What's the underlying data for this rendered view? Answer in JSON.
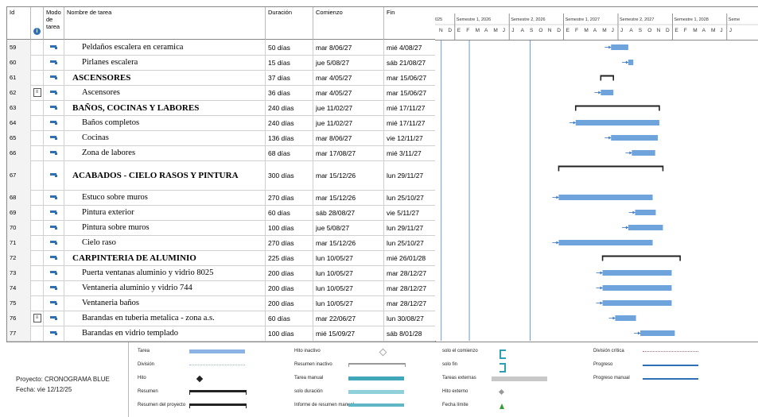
{
  "grid": {
    "headers": {
      "id": "Id",
      "mode": "Modo de tarea",
      "name": "Nombre de tarea",
      "duration": "Duración",
      "start": "Comienzo",
      "end": "Fin"
    },
    "rows": [
      {
        "id": "59",
        "info": "",
        "name": "Peldaños escalera en ceramica",
        "duration": "50 días",
        "start": "mar 8/06/27",
        "end": "mié 4/08/27",
        "summary": false,
        "indent": 2
      },
      {
        "id": "60",
        "info": "",
        "name": "Pirlanes escalera",
        "duration": "15 días",
        "start": "jue 5/08/27",
        "end": "sáb 21/08/27",
        "summary": false,
        "indent": 2
      },
      {
        "id": "61",
        "info": "",
        "name": "ASCENSORES",
        "duration": "37 días",
        "start": "mar 4/05/27",
        "end": "mar 15/06/27",
        "summary": true,
        "indent": 1
      },
      {
        "id": "62",
        "info": "note",
        "name": "Ascensores",
        "duration": "36 días",
        "start": "mar 4/05/27",
        "end": "mar 15/06/27",
        "summary": false,
        "indent": 2
      },
      {
        "id": "63",
        "info": "",
        "name": "BAÑOS, COCINAS Y LABORES",
        "duration": "240 días",
        "start": "jue 11/02/27",
        "end": "mié 17/11/27",
        "summary": true,
        "indent": 1
      },
      {
        "id": "64",
        "info": "",
        "name": "Baños completos",
        "duration": "240 días",
        "start": "jue 11/02/27",
        "end": "mié 17/11/27",
        "summary": false,
        "indent": 2
      },
      {
        "id": "65",
        "info": "",
        "name": "Cocinas",
        "duration": "136 días",
        "start": "mar 8/06/27",
        "end": "vie 12/11/27",
        "summary": false,
        "indent": 2
      },
      {
        "id": "66",
        "info": "",
        "name": "Zona de labores",
        "duration": "68 días",
        "start": "mar 17/08/27",
        "end": "mié 3/11/27",
        "summary": false,
        "indent": 2
      },
      {
        "id": "67",
        "info": "",
        "name": "ACABADOS - CIELO RASOS Y PINTURA",
        "duration": "300 días",
        "start": "mar 15/12/26",
        "end": "lun 29/11/27",
        "summary": true,
        "indent": 1,
        "tall": true
      },
      {
        "id": "68",
        "info": "",
        "name": "Estuco sobre muros",
        "duration": "270 días",
        "start": "mar 15/12/26",
        "end": "lun 25/10/27",
        "summary": false,
        "indent": 2
      },
      {
        "id": "69",
        "info": "",
        "name": "Pintura exterior",
        "duration": "60 días",
        "start": "sáb 28/08/27",
        "end": "vie 5/11/27",
        "summary": false,
        "indent": 2
      },
      {
        "id": "70",
        "info": "",
        "name": "Pintura sobre muros",
        "duration": "100 días",
        "start": "jue 5/08/27",
        "end": "lun 29/11/27",
        "summary": false,
        "indent": 2
      },
      {
        "id": "71",
        "info": "",
        "name": "Cielo raso",
        "duration": "270 días",
        "start": "mar 15/12/26",
        "end": "lun 25/10/27",
        "summary": false,
        "indent": 2
      },
      {
        "id": "72",
        "info": "",
        "name": "CARPINTERIA DE ALUMINIO",
        "duration": "225 días",
        "start": "lun 10/05/27",
        "end": "mié 26/01/28",
        "summary": true,
        "indent": 1
      },
      {
        "id": "73",
        "info": "",
        "name": "Puerta ventanas aluminio y vidrio 8025",
        "duration": "200 días",
        "start": "lun 10/05/27",
        "end": "mar 28/12/27",
        "summary": false,
        "indent": 2
      },
      {
        "id": "74",
        "info": "",
        "name": "Ventaneria aluminio y vidrio 744",
        "duration": "200 días",
        "start": "lun 10/05/27",
        "end": "mar 28/12/27",
        "summary": false,
        "indent": 2
      },
      {
        "id": "75",
        "info": "",
        "name": "Ventaneria baños",
        "duration": "200 días",
        "start": "lun 10/05/27",
        "end": "mar 28/12/27",
        "summary": false,
        "indent": 2
      },
      {
        "id": "76",
        "info": "note",
        "name": "Barandas en tuberia metalica - zona a.s.",
        "duration": "60 días",
        "start": "mar 22/06/27",
        "end": "lun 30/08/27",
        "summary": false,
        "indent": 2
      },
      {
        "id": "77",
        "info": "",
        "name": "Barandas en vidrio templado",
        "duration": "100 días",
        "start": "mié 15/09/27",
        "end": "sáb 8/01/28",
        "summary": false,
        "indent": 2
      }
    ]
  },
  "timescale": {
    "semesters": [
      "025",
      "Semestre 1, 2026",
      "Semestre 2, 2026",
      "Semestre 1, 2027",
      "Semestre 2, 2027",
      "Semestre 1, 2028",
      "Seme"
    ],
    "months": [
      "N",
      "D",
      "E",
      "F",
      "M",
      "A",
      "M",
      "J",
      "J",
      "A",
      "S",
      "O",
      "N",
      "D",
      "E",
      "F",
      "M",
      "A",
      "M",
      "J",
      "J",
      "A",
      "S",
      "O",
      "N",
      "D",
      "E",
      "F",
      "M",
      "A",
      "M",
      "J",
      "J"
    ],
    "first_month": "2025-11"
  },
  "legend": {
    "project_label": "Proyecto: CRONOGRAMA BLUE",
    "date_label": "Fecha: vie 12/12/25",
    "items": [
      {
        "label": "Tarea",
        "swatch": "task"
      },
      {
        "label": "División",
        "swatch": "split"
      },
      {
        "label": "Hito",
        "swatch": "milestone"
      },
      {
        "label": "Resumen",
        "swatch": "summary"
      },
      {
        "label": "Resumen del proyecto",
        "swatch": "project-summary"
      },
      {
        "label": "Hito inactivo",
        "swatch": "inactive-milestone"
      },
      {
        "label": "Resumen inactivo",
        "swatch": "inactive-summary"
      },
      {
        "label": "Tarea manual",
        "swatch": "manual-task"
      },
      {
        "label": "solo duración",
        "swatch": "duration-only"
      },
      {
        "label": "Informe de resumen manual",
        "swatch": "manual-summary-rollup"
      },
      {
        "label": "solo el comienzo",
        "swatch": "start-only"
      },
      {
        "label": "solo fin",
        "swatch": "finish-only"
      },
      {
        "label": "Tareas externas",
        "swatch": "external-tasks"
      },
      {
        "label": "Hito externo",
        "swatch": "external-milestone"
      },
      {
        "label": "Fecha límite",
        "swatch": "deadline"
      },
      {
        "label": "División crítica",
        "swatch": "critical-split"
      },
      {
        "label": "Progreso",
        "swatch": "progress"
      },
      {
        "label": "Progreso manual",
        "swatch": "manual-progress"
      }
    ]
  },
  "colors": {
    "task": "#6fa3dc",
    "summary": "#222222",
    "link": "#3a78c4",
    "header_bg": "#ffffff"
  }
}
